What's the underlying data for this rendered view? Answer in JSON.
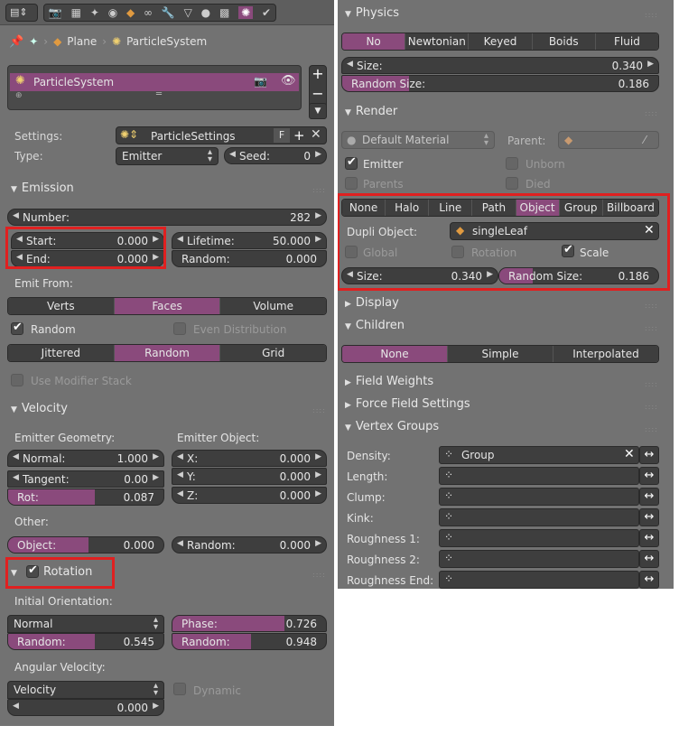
{
  "left": {
    "breadcrumb": {
      "object": "Plane",
      "particle_system": "ParticleSystem"
    },
    "list": {
      "item": "ParticleSystem"
    },
    "settings": {
      "label": "Settings:",
      "value": "ParticleSettings",
      "fake_user": "F"
    },
    "type": {
      "label": "Type:",
      "value": "Emitter",
      "seed_label": "Seed:",
      "seed_value": "0"
    },
    "emission": {
      "title": "Emission",
      "number_label": "Number:",
      "number_value": "282",
      "start_label": "Start:",
      "start_value": "0.000",
      "end_label": "End:",
      "end_value": "0.000",
      "lifetime_label": "Lifetime:",
      "lifetime_value": "50.000",
      "random_label": "Random:",
      "random_value": "0.000",
      "emit_from_label": "Emit From:",
      "emit_from_options": [
        "Verts",
        "Faces",
        "Volume"
      ],
      "random_check": "Random",
      "even_distribution": "Even Distribution",
      "distribution_options": [
        "Jittered",
        "Random",
        "Grid"
      ],
      "use_modifier_stack": "Use Modifier Stack"
    },
    "velocity": {
      "title": "Velocity",
      "emitter_geometry": "Emitter Geometry:",
      "emitter_object": "Emitter Object:",
      "normal_label": "Normal:",
      "normal_value": "1.000",
      "tangent_label": "Tangent:",
      "tangent_value": "0.00",
      "rot_label": "Rot:",
      "rot_value": "0.087",
      "x_label": "X:",
      "x_value": "0.000",
      "y_label": "Y:",
      "y_value": "0.000",
      "z_label": "Z:",
      "z_value": "0.000",
      "other_label": "Other:",
      "object_label": "Object:",
      "object_value": "0.000",
      "random_label": "Random:",
      "random_value": "0.000"
    },
    "rotation": {
      "title": "Rotation",
      "initial_orientation": "Initial Orientation:",
      "orientation_value": "Normal",
      "random_label": "Random:",
      "random_value": "0.545",
      "phase_label": "Phase:",
      "phase_value": "0.726",
      "phase_random_label": "Random:",
      "phase_random_value": "0.948",
      "angular_velocity": "Angular Velocity:",
      "velocity_mode": "Velocity",
      "velocity_value": "0.000",
      "dynamic": "Dynamic"
    }
  },
  "right": {
    "physics": {
      "title": "Physics",
      "options": [
        "No",
        "Newtonian",
        "Keyed",
        "Boids",
        "Fluid"
      ],
      "size_label": "Size:",
      "size_value": "0.340",
      "random_size_label": "Random Size:",
      "random_size_value": "0.186"
    },
    "render": {
      "title": "Render",
      "material": "Default Material",
      "parent_label": "Parent:",
      "emitter": "Emitter",
      "unborn": "Unborn",
      "parents": "Parents",
      "died": "Died",
      "modes": [
        "None",
        "Halo",
        "Line",
        "Path",
        "Object",
        "Group",
        "Billboard"
      ],
      "dupli_object_label": "Dupli Object:",
      "dupli_object_value": "singleLeaf",
      "global": "Global",
      "rotation": "Rotation",
      "scale": "Scale",
      "size_label": "Size:",
      "size_value": "0.340",
      "random_size_label": "Random Size:",
      "random_size_value": "0.186"
    },
    "display": {
      "title": "Display"
    },
    "children": {
      "title": "Children",
      "options": [
        "None",
        "Simple",
        "Interpolated"
      ]
    },
    "field_weights": {
      "title": "Field Weights"
    },
    "force_field_settings": {
      "title": "Force Field Settings"
    },
    "vertex_groups": {
      "title": "Vertex Groups",
      "rows": [
        {
          "label": "Density:",
          "value": "Group"
        },
        {
          "label": "Length:",
          "value": ""
        },
        {
          "label": "Clump:",
          "value": ""
        },
        {
          "label": "Kink:",
          "value": ""
        },
        {
          "label": "Roughness 1:",
          "value": ""
        },
        {
          "label": "Roughness 2:",
          "value": ""
        },
        {
          "label": "Roughness End:",
          "value": ""
        }
      ]
    }
  },
  "colors": {
    "panel": "#727272",
    "field": "#3e3e3e",
    "accent": "#8a4a7c",
    "highlight": "#e02020"
  }
}
